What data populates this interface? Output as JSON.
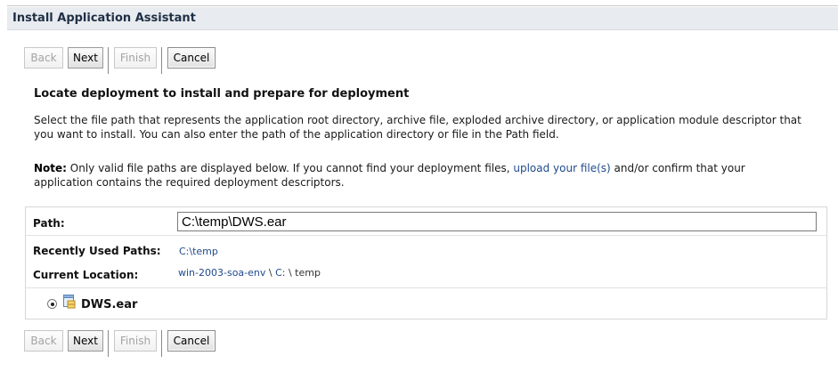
{
  "window": {
    "title": "Install Application Assistant"
  },
  "toolbar": {
    "back_label": "Back",
    "next_label": "Next",
    "finish_label": "Finish",
    "cancel_label": "Cancel"
  },
  "main": {
    "heading": "Locate deployment to install and prepare for deployment",
    "description_line1": "Select the file path that represents the application root directory, archive file, exploded archive directory, or application module descriptor that",
    "description_line2": "you want to install. You can also enter the path of the application directory or file in the Path field.",
    "note_label": "Note:",
    "note_text1": " Only valid file paths are displayed below. If you cannot find your deployment files, ",
    "note_link": "upload your file(s)",
    "note_text2": " and/or confirm that your",
    "note_line2": "application contains the required deployment descriptors."
  },
  "path_panel": {
    "path_label": "Path:",
    "path_value": "C:\\temp\\DWS.ear",
    "recent_label": "Recently Used Paths:",
    "recent_value": "C:\\temp",
    "location_label": "Current Location:",
    "location_host": "win-2003-soa-env",
    "location_sep1": " \\ ",
    "location_drive": "C:",
    "location_sep2": " \\ temp",
    "file_name": "DWS.ear",
    "file_icon": "archive-file-icon",
    "file_selected": true
  },
  "colors": {
    "title_bg": "#e8ebef",
    "link": "#1f4a8c",
    "disabled_text": "#a3a3a3"
  }
}
